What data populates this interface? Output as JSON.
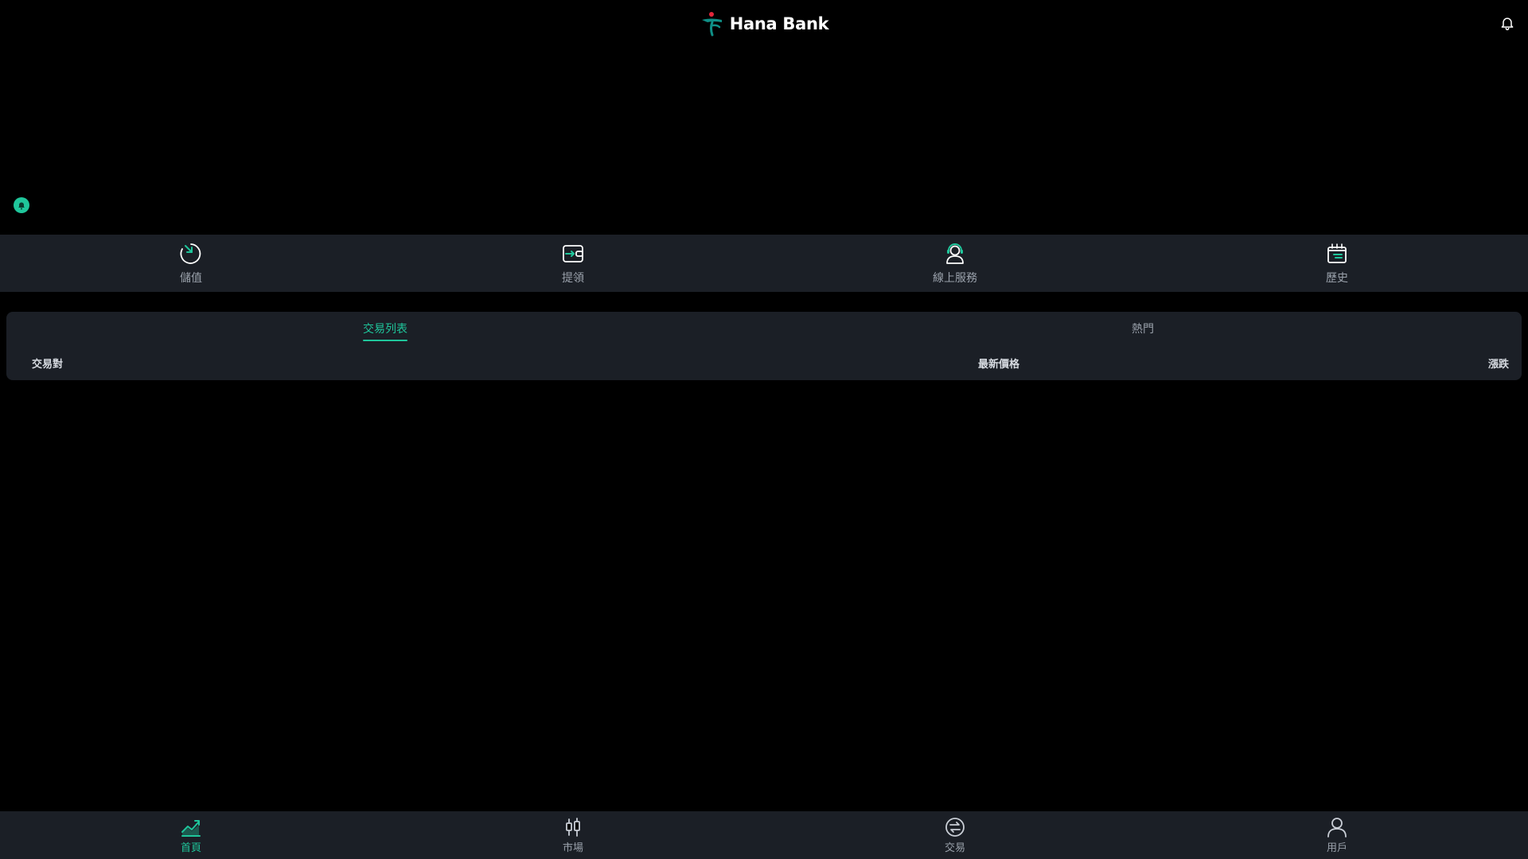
{
  "header": {
    "brand_name": "Hana Bank"
  },
  "quick_actions": [
    {
      "label": "儲值",
      "icon": "deposit-icon"
    },
    {
      "label": "提領",
      "icon": "withdraw-icon"
    },
    {
      "label": "線上服務",
      "icon": "customer-service-icon"
    },
    {
      "label": "歷史",
      "icon": "history-icon"
    }
  ],
  "market": {
    "tabs": [
      {
        "label": "交易列表",
        "active": true
      },
      {
        "label": "熱門",
        "active": false
      }
    ],
    "columns": {
      "pair": "交易對",
      "price": "最新價格",
      "change": "漲跌"
    }
  },
  "bottom_nav": [
    {
      "label": "首頁",
      "icon": "home-chart-icon",
      "active": true
    },
    {
      "label": "市場",
      "icon": "candlestick-icon",
      "active": false
    },
    {
      "label": "交易",
      "icon": "exchange-icon",
      "active": false
    },
    {
      "label": "用戶",
      "icon": "user-icon",
      "active": false
    }
  ],
  "colors": {
    "accent": "#1fc69b",
    "panel": "#1b1f26",
    "background": "#000000",
    "brand_red": "#e2263a",
    "brand_teal": "#0f8f86"
  }
}
